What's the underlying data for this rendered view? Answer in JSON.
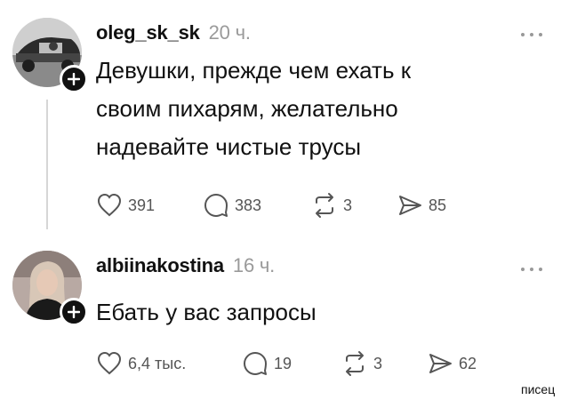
{
  "posts": [
    {
      "username": "oleg_sk_sk",
      "time": "20 ч.",
      "avatar_icon": "car-driver-photo-icon",
      "text_lines": [
        "Девушки, прежде чем ехать к",
        "своим пихарям, желательно",
        "надевайте чистые трусы"
      ],
      "likes": "391",
      "comments": "383",
      "reposts": "3",
      "shares": "85"
    },
    {
      "username": "albiinakostina",
      "time": "16 ч.",
      "avatar_icon": "woman-portrait-photo-icon",
      "text_lines": [
        "Ебать у вас запросы"
      ],
      "likes": "6,4 тыс.",
      "comments": "19",
      "reposts": "3",
      "shares": "62"
    }
  ],
  "watermark": "писец",
  "colors": {
    "text": "#111111",
    "muted": "#9a9a9a",
    "thread_line": "#d6d6d6",
    "background": "#ffffff"
  }
}
